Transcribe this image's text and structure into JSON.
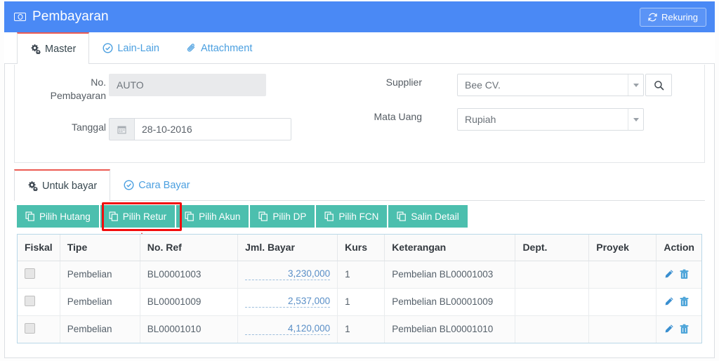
{
  "header": {
    "title": "Pembayaran",
    "title_icon": "money-bill-icon",
    "recurring_button": {
      "label": "Rekuring",
      "icon": "sync-icon"
    },
    "bg_color": "#4a89f5"
  },
  "top_tabs": [
    {
      "id": "master",
      "label": "Master",
      "icon": "gears-icon",
      "active": true
    },
    {
      "id": "lain-lain",
      "label": "Lain-Lain",
      "icon": "check-circle-icon",
      "active": false
    },
    {
      "id": "attachment",
      "label": "Attachment",
      "icon": "paperclip-icon",
      "active": false
    }
  ],
  "form": {
    "no_pembayaran": {
      "label_line1": "No.",
      "label_line2": "Pembayaran",
      "value": "AUTO",
      "readonly": true
    },
    "tanggal": {
      "label": "Tanggal",
      "value": "28-10-2016",
      "icon": "calendar-icon"
    },
    "supplier": {
      "label": "Supplier",
      "value": "Bee CV.",
      "caret_icon": "chevron-down-icon",
      "search_icon": "search-icon"
    },
    "mata_uang": {
      "label": "Mata Uang",
      "value": "Rupiah",
      "caret_icon": "chevron-down-icon"
    }
  },
  "sub_tabs": [
    {
      "id": "untuk-bayar",
      "label": "Untuk bayar",
      "icon": "gears-icon",
      "active": true
    },
    {
      "id": "cara-bayar",
      "label": "Cara Bayar",
      "icon": "check-circle-icon",
      "active": false
    }
  ],
  "toolbar": {
    "color": "#4cbfae",
    "buttons": [
      {
        "id": "pilih-hutang",
        "label": "Pilih Hutang",
        "icon": "copy-icon",
        "highlighted": false
      },
      {
        "id": "pilih-retur",
        "label": "Pilih Retur",
        "icon": "copy-icon",
        "highlighted": true
      },
      {
        "id": "pilih-akun",
        "label": "Pilih Akun",
        "icon": "copy-icon",
        "highlighted": false
      },
      {
        "id": "pilih-dp",
        "label": "Pilih DP",
        "icon": "copy-icon",
        "highlighted": false
      },
      {
        "id": "pilih-fcn",
        "label": "Pilih FCN",
        "icon": "copy-icon",
        "highlighted": false
      },
      {
        "id": "salin-detail",
        "label": "Salin Detail",
        "icon": "copy-icon",
        "highlighted": false
      }
    ]
  },
  "annotation": {
    "type": "highlight-box-with-arrow",
    "target": "pilih-retur",
    "color": "#f20d0d"
  },
  "table": {
    "columns": [
      "Fiskal",
      "Tipe",
      "No. Ref",
      "Jml. Bayar",
      "Kurs",
      "Keterangan",
      "Dept.",
      "Proyek",
      "Action"
    ],
    "rows": [
      {
        "fiskal": "",
        "tipe": "Pembelian",
        "no_ref": "BL00001003",
        "jml_bayar": "3,230,000",
        "kurs": "1",
        "keterangan": "Pembelian BL00001003",
        "dept": "",
        "proyek": "",
        "actions": [
          "edit-icon",
          "delete-icon"
        ]
      },
      {
        "fiskal": "",
        "tipe": "Pembelian",
        "no_ref": "BL00001009",
        "jml_bayar": "2,537,000",
        "kurs": "1",
        "keterangan": "Pembelian BL00001009",
        "dept": "",
        "proyek": "",
        "actions": [
          "edit-icon",
          "delete-icon"
        ]
      },
      {
        "fiskal": "",
        "tipe": "Pembelian",
        "no_ref": "BL00001010",
        "jml_bayar": "4,120,000",
        "kurs": "1",
        "keterangan": "Pembelian BL00001010",
        "dept": "",
        "proyek": "",
        "actions": [
          "edit-icon",
          "delete-icon"
        ]
      }
    ]
  }
}
